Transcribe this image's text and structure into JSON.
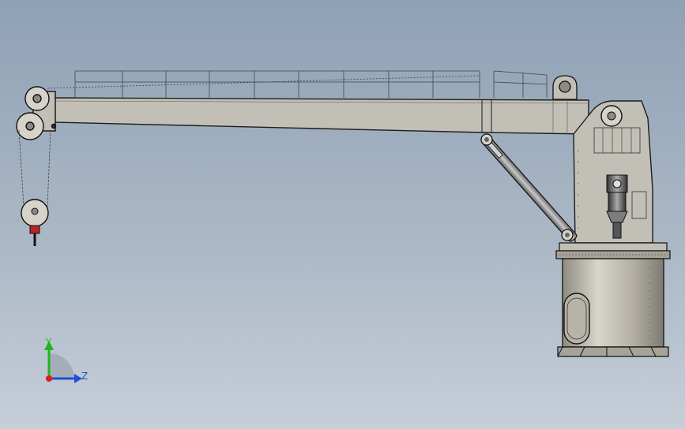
{
  "viewport": {
    "background_top": "#8fa1b6",
    "background_bottom": "#c6ced8"
  },
  "crane": {
    "body_color": "#c2bfb6",
    "outline_color": "#1d1d1d",
    "pedestal_color": "#b8b4a8",
    "hydraulic_cylinder_color": "#9a9a9a"
  },
  "triad": {
    "y_label": "Y",
    "z_label": "Z",
    "y_color": "#1fb51f",
    "z_color": "#1f4fd8",
    "x_color": "#d81f1f"
  }
}
